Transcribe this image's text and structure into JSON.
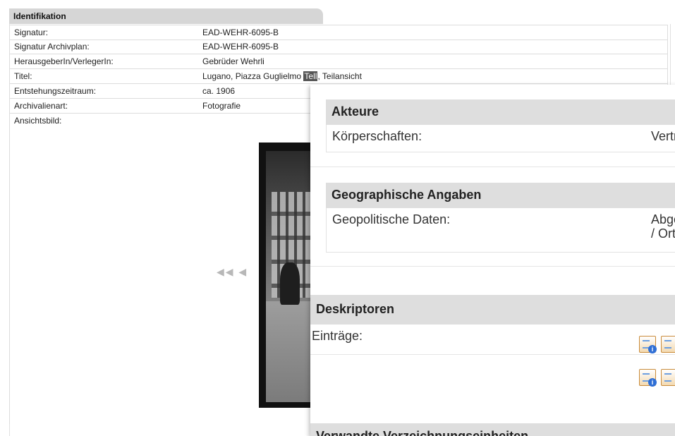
{
  "identifikation": {
    "title": "Identifikation",
    "rows": [
      {
        "label": "Signatur:",
        "value": "EAD-WEHR-6095-B"
      },
      {
        "label": "Signatur Archivplan:",
        "value": "EAD-WEHR-6095-B"
      },
      {
        "label": "HerausgeberIn/VerlegerIn:",
        "value": "Gebrüder Wehrli"
      },
      {
        "label": "Titel:",
        "value_pre": "Lugano, Piazza Guglie",
        "value_hidden": "lmo ",
        "value_hl": "Tell",
        "value_post": ", Teilansicht"
      },
      {
        "label": "Entstehungszeitraum:",
        "value": "ca. 1906"
      },
      {
        "label": "Archivalienart:",
        "value": "Fotografie"
      },
      {
        "label": "Ansichtsbild:",
        "value": ""
      }
    ],
    "nav_arrows": "◀◀ ◀"
  },
  "overlay": {
    "akteure": {
      "title": "Akteure",
      "row_label": "Körperschaften:",
      "row_value": "Vertr"
    },
    "geo": {
      "title": "Geographische Angaben",
      "row_label": "Geopolitische Daten:",
      "row_value_1": "Abge",
      "row_value_2": "/ Ort"
    },
    "deskriptoren": {
      "title": "Deskriptoren",
      "row_label": "Einträge:"
    },
    "verwandte": {
      "title": "Verwandte Verzeichnungseinheiten"
    }
  }
}
